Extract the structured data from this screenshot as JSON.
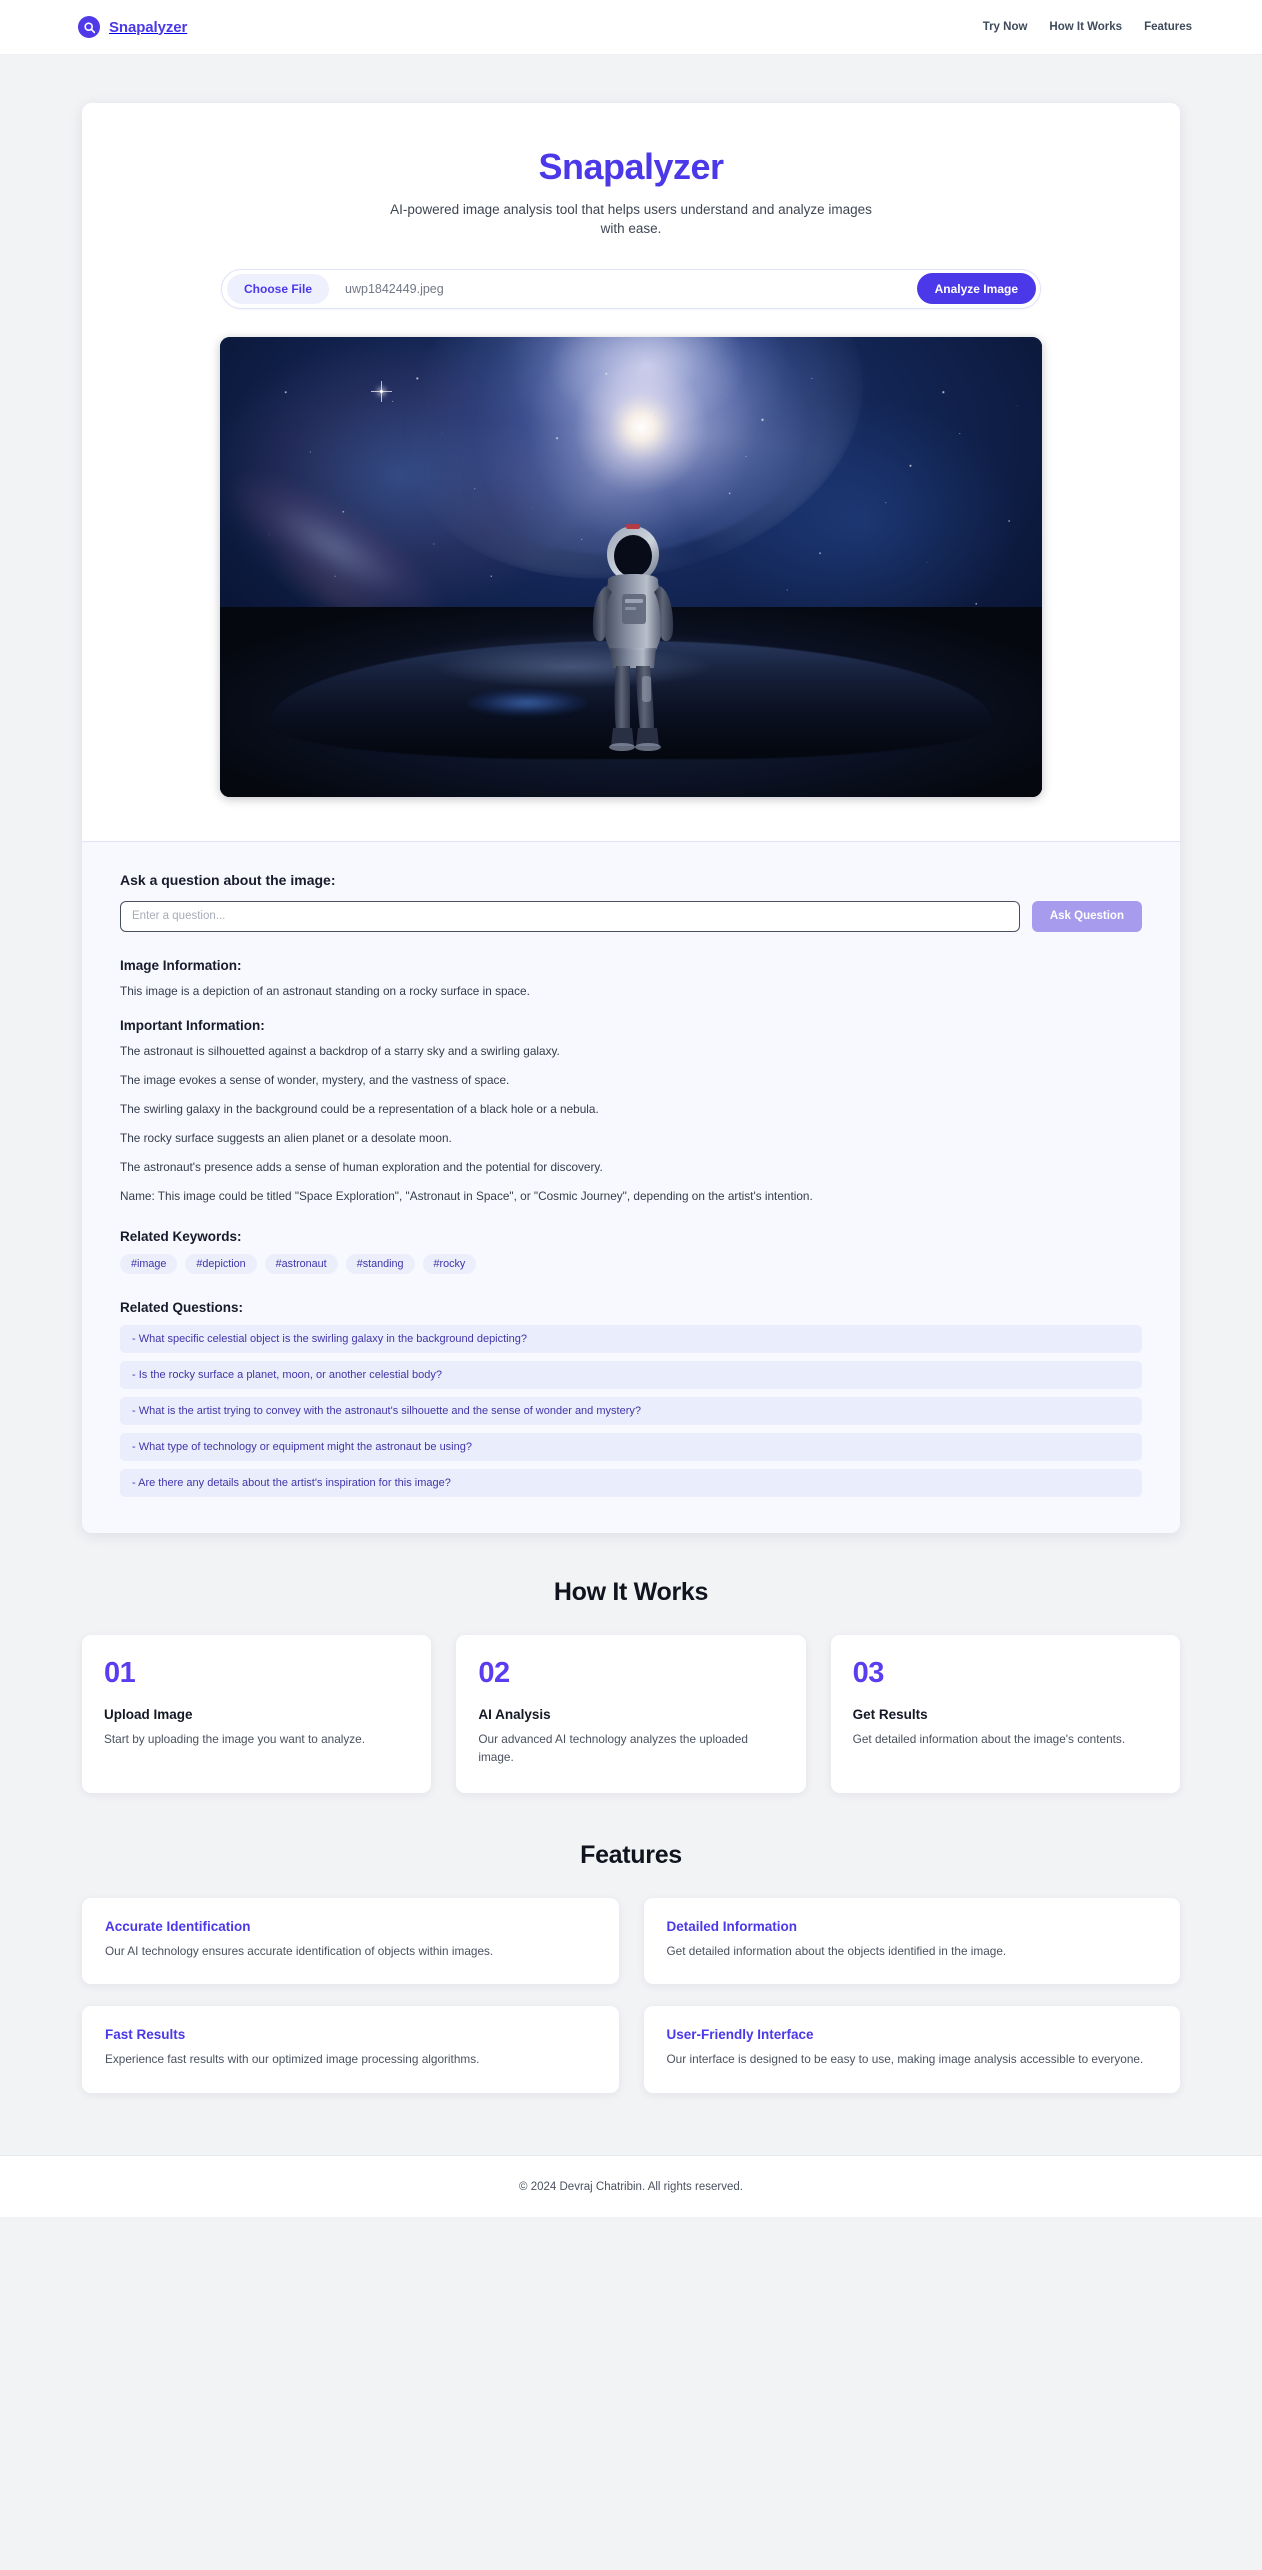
{
  "brand": {
    "name": "Snapalyzer",
    "logo_icon": "search-icon",
    "accent_color": "#4b38e8"
  },
  "nav": {
    "links": [
      {
        "label": "Try Now"
      },
      {
        "label": "How It Works"
      },
      {
        "label": "Features"
      }
    ]
  },
  "hero": {
    "title": "Snapalyzer",
    "subtitle": "AI-powered image analysis tool that helps users understand and analyze images with ease.",
    "choose_file_label": "Choose File",
    "file_name": "uwp1842449.jpeg",
    "analyze_label": "Analyze Image",
    "preview_alt": "Astronaut standing on a rocky surface in space with a swirling galaxy"
  },
  "results": {
    "ask_heading": "Ask a question about the image:",
    "ask_placeholder": "Enter a question...",
    "ask_value": "",
    "ask_button_label": "Ask Question",
    "image_information_title": "Image Information:",
    "image_information_text": "This image is a depiction of an astronaut standing on a rocky surface in space.",
    "important_information_title": "Important Information:",
    "important_information": [
      "The astronaut is silhouetted against a backdrop of a starry sky and a swirling galaxy.",
      "The image evokes a sense of wonder, mystery, and the vastness of space.",
      "The swirling galaxy in the background could be a representation of a black hole or a nebula.",
      "The rocky surface suggests an alien planet or a desolate moon.",
      "The astronaut's presence adds a sense of human exploration and the potential for discovery.",
      "Name: This image could be titled \"Space Exploration\", \"Astronaut in Space\", or \"Cosmic Journey\", depending on the artist's intention."
    ],
    "keywords_title": "Related Keywords:",
    "keywords": [
      "#image",
      "#depiction",
      "#astronaut",
      "#standing",
      "#rocky"
    ],
    "questions_title": "Related Questions:",
    "questions": [
      "- What specific celestial object is the swirling galaxy in the background depicting?",
      "- Is the rocky surface a planet, moon, or another celestial body?",
      "- What is the artist trying to convey with the astronaut's silhouette and the sense of wonder and mystery?",
      "- What type of technology or equipment might the astronaut be using?",
      "- Are there any details about the artist's inspiration for this image?"
    ]
  },
  "how_it_works": {
    "heading": "How It Works",
    "steps": [
      {
        "number": "01",
        "name": "Upload Image",
        "desc": "Start by uploading the image you want to analyze."
      },
      {
        "number": "02",
        "name": "AI Analysis",
        "desc": "Our advanced AI technology analyzes the uploaded image."
      },
      {
        "number": "03",
        "name": "Get Results",
        "desc": "Get detailed information about the image's contents."
      }
    ]
  },
  "features": {
    "heading": "Features",
    "items": [
      {
        "title": "Accurate Identification",
        "desc": "Our AI technology ensures accurate identification of objects within images."
      },
      {
        "title": "Detailed Information",
        "desc": "Get detailed information about the objects identified in the image."
      },
      {
        "title": "Fast Results",
        "desc": "Experience fast results with our optimized image processing algorithms."
      },
      {
        "title": "User-Friendly Interface",
        "desc": "Our interface is designed to be easy to use, making image analysis accessible to everyone."
      }
    ]
  },
  "footer": {
    "text": "© 2024 Devraj Chatribin. All rights reserved."
  }
}
